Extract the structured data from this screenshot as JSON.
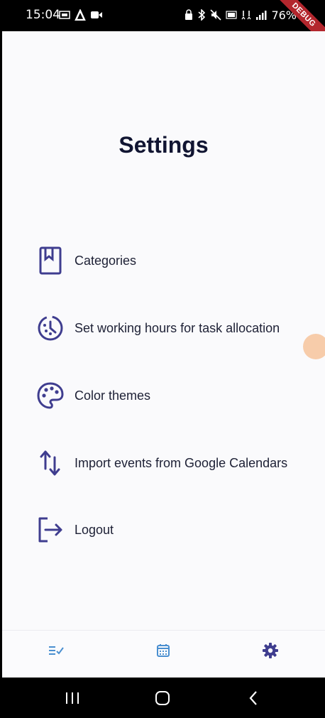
{
  "status_bar": {
    "time": "15:04",
    "battery": "76%",
    "debug_banner": "DEBUG"
  },
  "page": {
    "title": "Settings"
  },
  "menu": [
    {
      "label": "Categories",
      "icon": "bookmark-book-icon"
    },
    {
      "label": "Set working hours for task allocation",
      "icon": "clock-dashed-icon"
    },
    {
      "label": "Color themes",
      "icon": "palette-icon"
    },
    {
      "label": "Import events from Google Calendars",
      "icon": "import-arrows-icon"
    },
    {
      "label": "Logout",
      "icon": "logout-icon"
    }
  ],
  "bottom_nav": [
    {
      "name": "tasks",
      "icon": "checklist-icon",
      "active": false
    },
    {
      "name": "calendar",
      "icon": "calendar-icon",
      "active": false
    },
    {
      "name": "settings",
      "icon": "gear-icon",
      "active": true
    }
  ],
  "colors": {
    "accent": "#3f3d8f",
    "inactive_nav": "#4a8fd0",
    "title": "#111532",
    "background": "#fafafc"
  }
}
